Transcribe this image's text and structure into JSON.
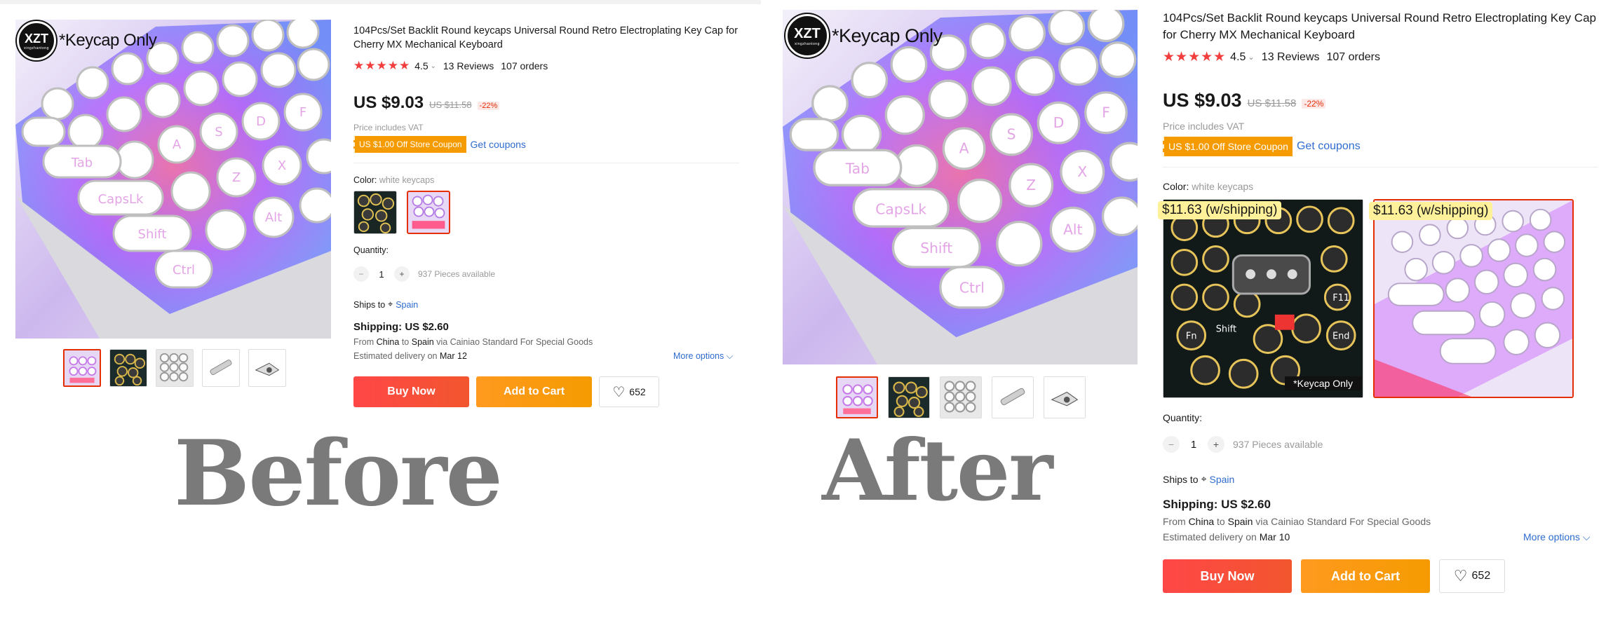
{
  "brand": {
    "logo": "XZT",
    "logo_sub": "xingzhantong",
    "tag": "*Keycap Only"
  },
  "thumb_keycap_label": "*Keycap Only",
  "product": {
    "title": "104Pcs/Set Backlit Round keycaps Universal Round Retro Electroplating Key Cap for Cherry MX Mechanical Keyboard",
    "stars": "★★★★★",
    "rating": "4.5",
    "chevron": "⌄",
    "reviews": "13 Reviews",
    "orders": "107 orders",
    "price": "US $9.03",
    "old_price": "US $11.58",
    "discount": "-22%",
    "vat": "Price includes VAT",
    "coupon": "US $1.00 Off Store Coupon",
    "get_coupons": "Get coupons",
    "color_label": "Color:",
    "color_value": "white keycaps",
    "quantity_label": "Quantity:",
    "minus": "−",
    "plus": "+",
    "quantity": "1",
    "available": "937 Pieces available",
    "ships_to_label": "Ships to",
    "pin": "⌖",
    "country": "Spain",
    "shipping": "Shipping: US $2.60",
    "from_prefix": "From",
    "from_country": "China",
    "to_word": "to",
    "to_country": "Spain",
    "via": "via Cainiao Standard For Special Goods",
    "delivery_prefix": "Estimated delivery on",
    "more_options": "More options",
    "more_chevron": "⌵",
    "buy_now": "Buy Now",
    "add_to_cart": "Add to Cart",
    "heart": "♡",
    "wishlist_count": "652"
  },
  "before": {
    "caption": "Before",
    "delivery_date": "Mar 12"
  },
  "after": {
    "caption": "After",
    "delivery_date": "Mar 10",
    "swatch_badge": "$11.63 (w/shipping)"
  },
  "colors": {
    "accent_red": "#e62e04",
    "buy": "#ff4747",
    "cart": "#f59b00",
    "link": "#2e6ccf",
    "star": "#f33d3d",
    "badge": "#fff09a"
  }
}
